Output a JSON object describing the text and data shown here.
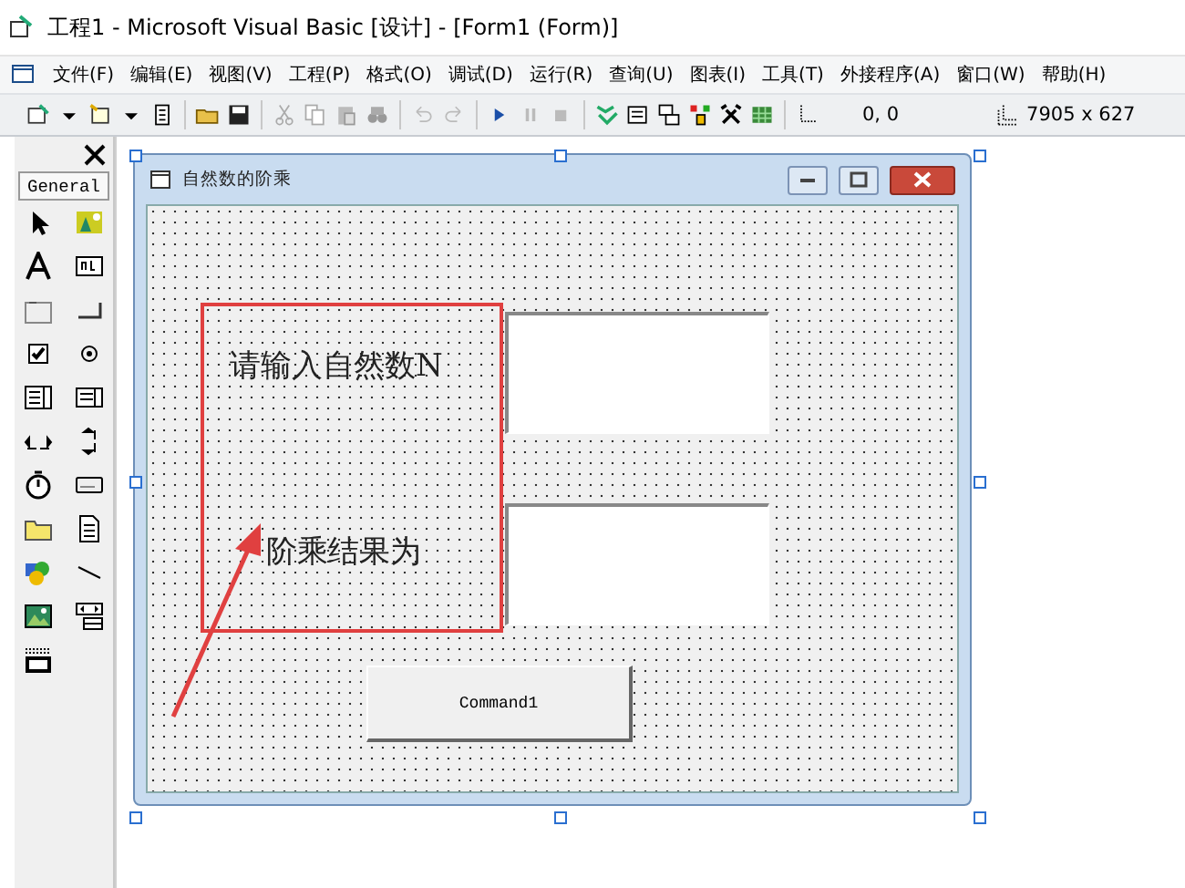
{
  "window": {
    "title": "工程1 - Microsoft Visual Basic [设计] - [Form1 (Form)]"
  },
  "menu_bar": [
    "文件(F)",
    "编辑(E)",
    "视图(V)",
    "工程(P)",
    "格式(O)",
    "调试(D)",
    "运行(R)",
    "查询(U)",
    "图表(I)",
    "工具(T)",
    "外接程序(A)",
    "窗口(W)",
    "帮助(H)"
  ],
  "toolbar": {
    "position": "0, 0",
    "size": "7905 x 627"
  },
  "toolbox": {
    "tab": "General"
  },
  "form": {
    "title": "自然数的阶乘",
    "controls": [
      {
        "kind": "label",
        "caption": "请输入自然数N"
      },
      {
        "kind": "textbox"
      },
      {
        "kind": "label",
        "caption": "阶乘结果为"
      },
      {
        "kind": "textbox"
      },
      {
        "kind": "button",
        "caption": "Command1"
      }
    ]
  }
}
